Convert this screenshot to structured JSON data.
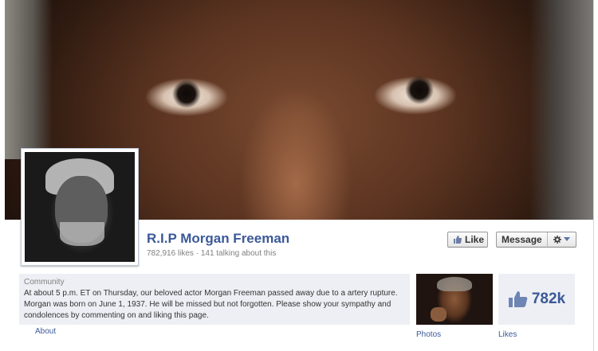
{
  "page": {
    "name": "R.I.P Morgan Freeman",
    "stats": "782,916 likes · 141 talking about this"
  },
  "actions": {
    "like_label": "Like",
    "message_label": "Message",
    "gear_icon": "gear-icon"
  },
  "about": {
    "category": "Community",
    "description": "At about 5 p.m. ET on Thursday, our beloved actor Morgan Freeman passed away due to a artery rupture. Morgan was born on June 1, 1937. He will be missed but not forgotten. Please show your sympathy and condolences by commenting on and liking this page.",
    "link_label": "About"
  },
  "apps": [
    {
      "label": "Photos"
    },
    {
      "label": "Likes",
      "count": "782k"
    }
  ],
  "colors": {
    "link": "#3b5998",
    "panel_bg": "#edeff4",
    "muted_text": "#808080"
  }
}
